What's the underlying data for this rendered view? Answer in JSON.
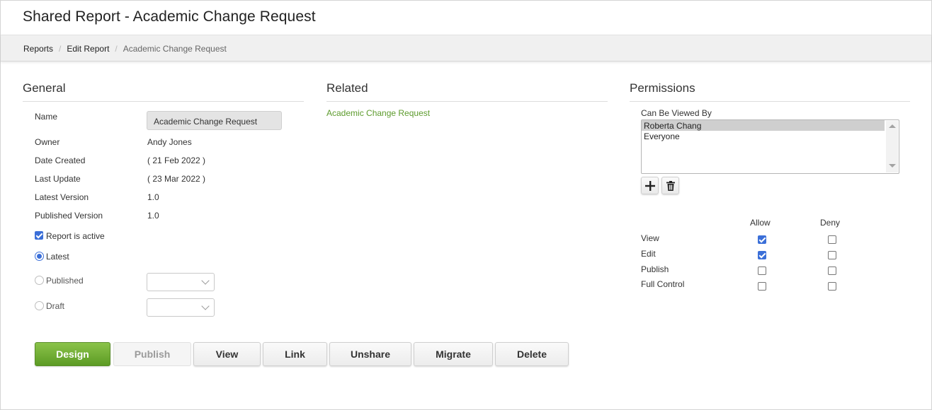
{
  "page": {
    "title": "Shared Report - Academic Change Request"
  },
  "breadcrumb": {
    "items": [
      "Reports",
      "Edit Report",
      "Academic Change Request"
    ],
    "separator": "/"
  },
  "general": {
    "heading": "General",
    "name_label": "Name",
    "name_value": "Academic Change Request",
    "fields": [
      {
        "label": "Owner",
        "value": "Andy Jones"
      },
      {
        "label": "Date Created",
        "value": "( 21 Feb 2022 )"
      },
      {
        "label": "Last Update",
        "value": "( 23 Mar 2022 )"
      },
      {
        "label": "Latest Version",
        "value": "1.0"
      },
      {
        "label": "Published Version",
        "value": "1.0"
      }
    ],
    "active": {
      "label": "Report is active",
      "checked": true
    },
    "versions": [
      {
        "label": "Latest",
        "selected": true
      },
      {
        "label": "Published",
        "selected": false,
        "dropdown_value": ""
      },
      {
        "label": "Draft",
        "selected": false,
        "dropdown_value": ""
      }
    ]
  },
  "related": {
    "heading": "Related",
    "link": "Academic Change Request"
  },
  "permissions": {
    "heading": "Permissions",
    "viewers_label": "Can Be Viewed By",
    "viewers": [
      {
        "name": "Roberta Chang",
        "selected": true
      },
      {
        "name": "Everyone",
        "selected": false
      }
    ],
    "add_icon": "plus-icon",
    "delete_icon": "trash-icon",
    "columns": [
      "Allow",
      "Deny"
    ],
    "rows": [
      {
        "label": "View",
        "allow": true,
        "deny": false
      },
      {
        "label": "Edit",
        "allow": true,
        "deny": false
      },
      {
        "label": "Publish",
        "allow": false,
        "deny": false
      },
      {
        "label": "Full Control",
        "allow": false,
        "deny": false
      }
    ]
  },
  "actions": {
    "design": "Design",
    "publish": "Publish",
    "view": "View",
    "link": "Link",
    "unshare": "Unshare",
    "migrate": "Migrate",
    "delete": "Delete"
  },
  "colors": {
    "accent_green": "#6aab2e",
    "link_green": "#5d9b2d",
    "check_blue": "#3b6fd8"
  }
}
